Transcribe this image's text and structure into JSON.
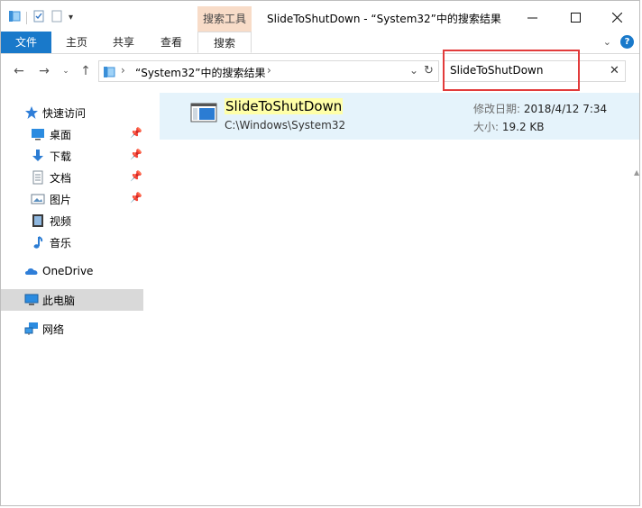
{
  "titlebar": {
    "title": "SlideToShutDown - “System32”中的搜索结果",
    "context_tab_group": "搜索工具"
  },
  "ribbon": {
    "tabs": [
      "文件",
      "主页",
      "共享",
      "查看",
      "搜索"
    ],
    "active_tab": "搜索"
  },
  "address": {
    "path": "“System32”中的搜索结果"
  },
  "search": {
    "value": "SlideToShutDown"
  },
  "nav": {
    "quick_access": "快速访问",
    "items": [
      "桌面",
      "下载",
      "文档",
      "图片",
      "视频",
      "音乐"
    ],
    "onedrive": "OneDrive",
    "this_pc": "此电脑",
    "network": "网络"
  },
  "results": [
    {
      "name": "SlideToShutDown",
      "path": "C:\\Windows\\System32",
      "modified_label": "修改日期:",
      "modified": "2018/4/12 7:34",
      "size_label": "大小:",
      "size": "19.2 KB"
    }
  ],
  "colors": {
    "accent": "#1979ca",
    "context_tab": "#f8dcc8",
    "selection": "#e5f3fb",
    "match_highlight": "#ffffa8",
    "annotation": "#e23b3b"
  }
}
